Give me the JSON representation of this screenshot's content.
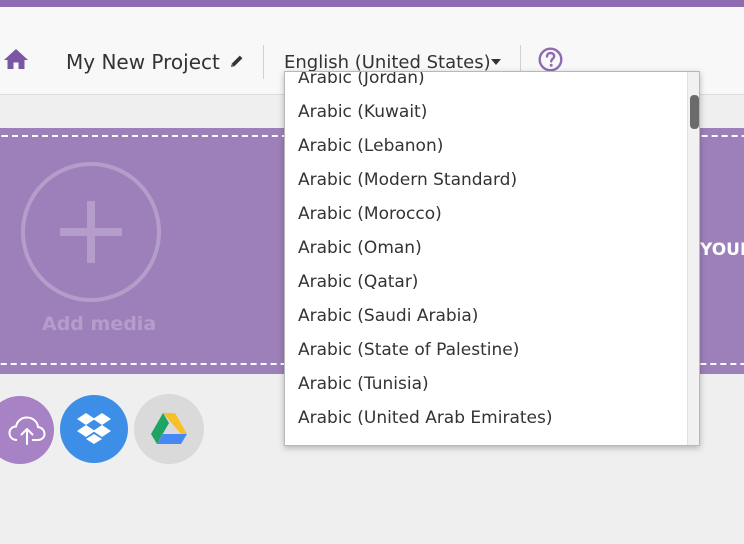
{
  "header": {
    "project_title": "My New Project",
    "language": "English (United States)"
  },
  "upload_area": {
    "add_media_label": "Add media",
    "drop_text": "YOUR"
  },
  "language_dropdown": {
    "options": [
      "Arabic (Jordan)",
      "Arabic (Kuwait)",
      "Arabic (Lebanon)",
      "Arabic (Modern Standard)",
      "Arabic (Morocco)",
      "Arabic (Oman)",
      "Arabic (Qatar)",
      "Arabic (Saudi Arabia)",
      "Arabic (State of Palestine)",
      "Arabic (Tunisia)",
      "Arabic (United Arab Emirates)"
    ]
  },
  "icons": {
    "home": "home-icon",
    "edit": "pencil-icon",
    "caret": "caret-down-icon",
    "help": "question-mark-icon",
    "upload": "cloud-upload-icon",
    "dropbox": "dropbox-icon",
    "drive": "google-drive-icon"
  },
  "colors": {
    "accent": "#8e6cb3",
    "panel": "#9d80b9",
    "dropbox": "#3d8ee6"
  }
}
